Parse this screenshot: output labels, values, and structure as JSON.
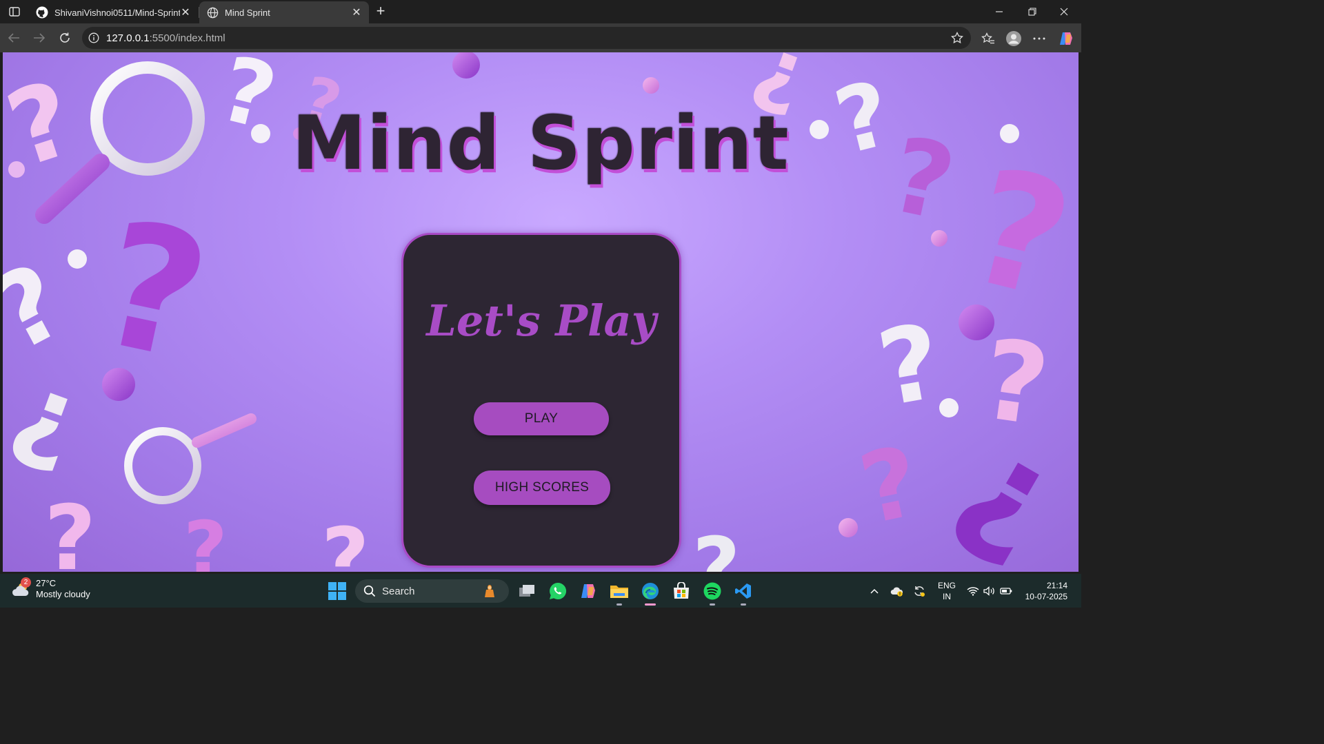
{
  "browser": {
    "tabs": [
      {
        "title": "ShivaniVishnoi0511/Mind-Sprint",
        "favicon": "github-icon",
        "active": false
      },
      {
        "title": "Mind Sprint",
        "favicon": "globe-icon",
        "active": true
      }
    ],
    "url": {
      "host": "127.0.0.1",
      "path": ":5500/index.html"
    }
  },
  "page": {
    "title": "Mind Sprint",
    "card_heading": "Let's Play",
    "play_label": "PLAY",
    "high_scores_label": "HIGH SCORES",
    "colors": {
      "background": "#b38ef5",
      "card": "#2d2633",
      "accent": "#a64cc0",
      "title_text": "#2e2433"
    }
  },
  "taskbar": {
    "weather": {
      "temp": "27°C",
      "condition": "Mostly cloudy",
      "badge": "2"
    },
    "search_placeholder": "Search",
    "language": {
      "line1": "ENG",
      "line2": "IN"
    },
    "time": "21:14",
    "date": "10-07-2025"
  }
}
